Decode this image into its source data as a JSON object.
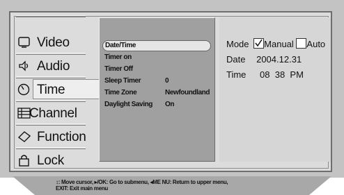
{
  "left_menu": {
    "items": [
      {
        "label": "Video",
        "icon": "tv-icon"
      },
      {
        "label": "Audio",
        "icon": "speaker-icon"
      },
      {
        "label": "Time",
        "icon": "clock-icon",
        "selected": true
      },
      {
        "label": "Channel",
        "icon": "channel-list-icon"
      },
      {
        "label": "Function",
        "icon": "function-tag-icon"
      },
      {
        "label": "Lock",
        "icon": "lock-icon"
      }
    ]
  },
  "time_menu": {
    "items": [
      {
        "label": "Date/Time",
        "value": "",
        "selected": true
      },
      {
        "label": "Timer on",
        "value": ""
      },
      {
        "label": "Timer Off",
        "value": ""
      },
      {
        "label": "Sleep Timer",
        "value": "0"
      },
      {
        "label": "Time Zone",
        "value": "Newfoundland"
      },
      {
        "label": "Daylight Saving",
        "value": "On"
      }
    ]
  },
  "date_time": {
    "mode_label": "Mode",
    "manual_label": "Manual",
    "manual_checked": true,
    "auto_label": "Auto",
    "auto_checked": false,
    "date_label": "Date",
    "date_value": "2004.12.31",
    "time_label": "Time",
    "time_value": "08  38  PM"
  },
  "help": {
    "line1": "↕: Move cursor, ▸/OK: Go to submenu, ◂ME NU: Return to upper menu,",
    "line2": "EXIT: Exit main menu"
  }
}
